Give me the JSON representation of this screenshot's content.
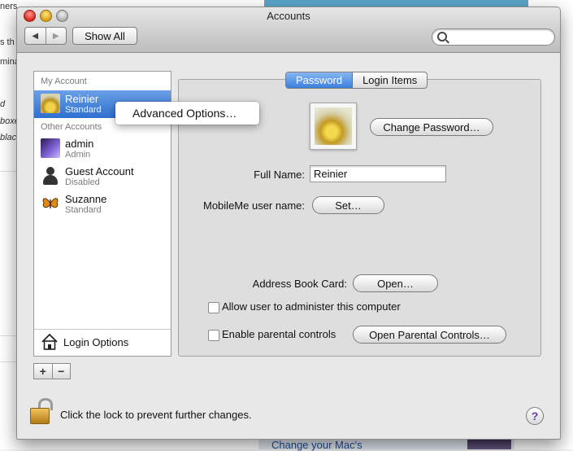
{
  "background": {
    "left_fragments": [
      "ners",
      "s th",
      "mina",
      "d",
      "boxe",
      "blac"
    ],
    "bottom_link": "Change your Mac's"
  },
  "window": {
    "title": "Accounts",
    "nav_back": "◀",
    "nav_forward": "▶",
    "show_all": "Show All",
    "search_placeholder": ""
  },
  "sidebar": {
    "my_account_header": "My Account",
    "other_accounts_header": "Other Accounts",
    "accounts": [
      {
        "name": "Reinier",
        "role": "Standard",
        "selected": true
      },
      {
        "name": "admin",
        "role": "Admin"
      },
      {
        "name": "Guest Account",
        "role": "Disabled"
      },
      {
        "name": "Suzanne",
        "role": "Standard"
      }
    ],
    "login_options": "Login Options",
    "add": "+",
    "remove": "−"
  },
  "context_menu": {
    "items": [
      "Advanced Options…"
    ]
  },
  "tabs": [
    {
      "label": "Password",
      "active": true
    },
    {
      "label": "Login Items",
      "active": false
    }
  ],
  "form": {
    "change_password": "Change Password…",
    "full_name_label": "Full Name:",
    "full_name_value": "Reinier",
    "mobileme_label": "MobileMe user name:",
    "set_button": "Set…",
    "address_book_label": "Address Book Card:",
    "open_button": "Open…",
    "allow_admin_label": "Allow user to administer this computer",
    "allow_admin_checked": false,
    "parental_label": "Enable parental controls",
    "parental_checked": false,
    "open_parental_button": "Open Parental Controls…"
  },
  "footer": {
    "lock_text": "Click the lock to prevent further changes.",
    "help": "?"
  }
}
